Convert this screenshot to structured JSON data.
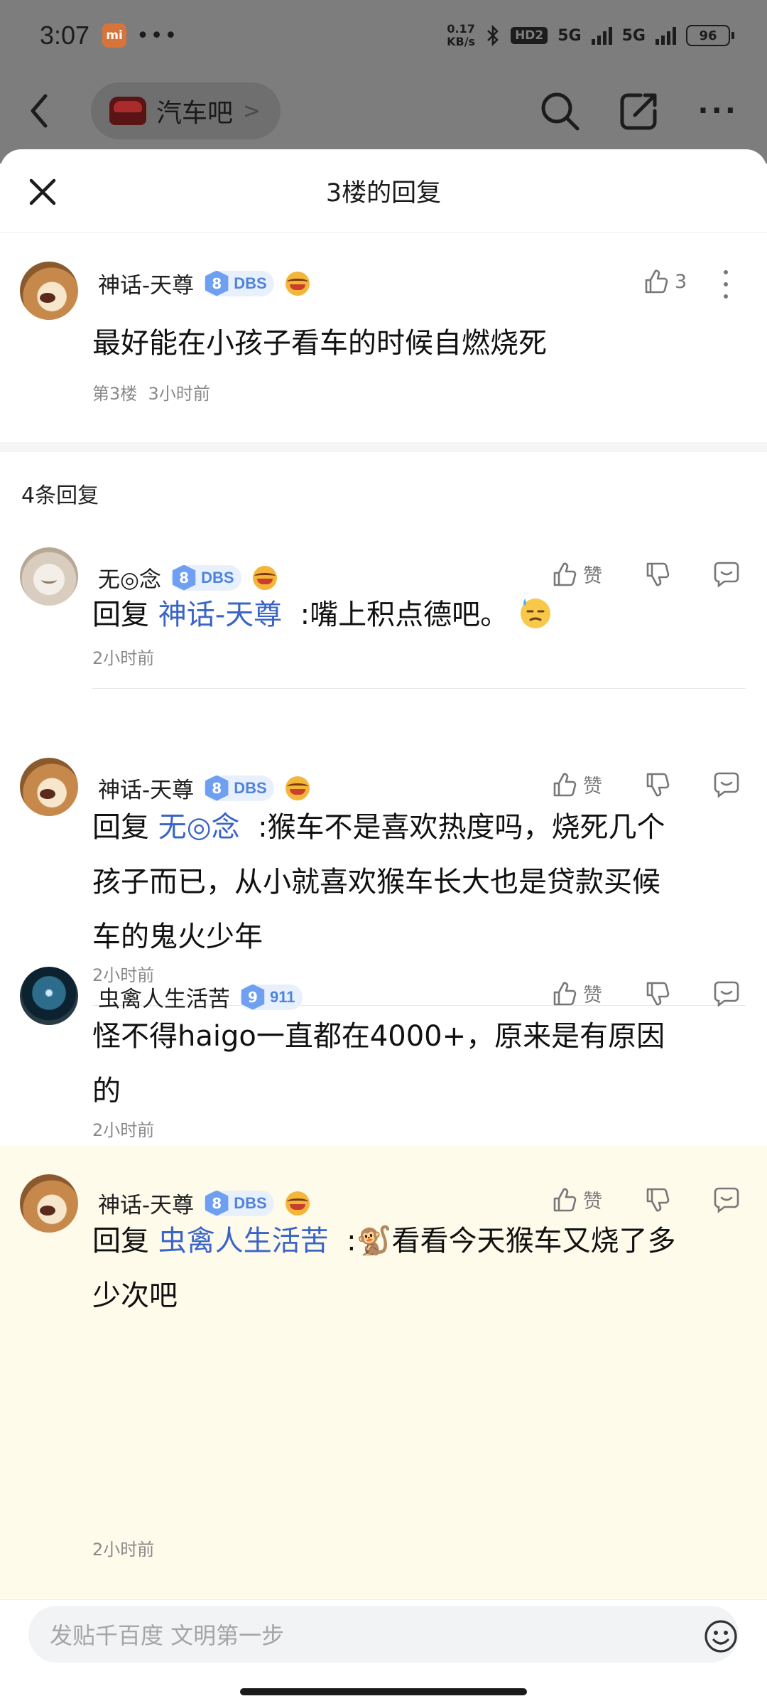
{
  "status_bar": {
    "time": "3:07",
    "net_speed_value": "0.17",
    "net_speed_unit": "KB/s",
    "network_1": "5G",
    "network_2": "5G",
    "hd_label": "HD2",
    "battery": "96"
  },
  "nav": {
    "forum_name": "汽车吧",
    "forum_arrow": ">",
    "more_icon": "more-dots"
  },
  "sheet": {
    "title": "3楼的回复"
  },
  "main_comment": {
    "username": "神话-天尊",
    "level": "8",
    "level_name": "DBS",
    "likes": "3",
    "text": "最好能在小孩子看车的时候自燃烧死",
    "floor": "第3楼",
    "time": "3小时前"
  },
  "reply_count": "4条回复",
  "reply_prefix": "回复",
  "like_label": "赞",
  "replies": [
    {
      "username": "无◎念",
      "level": "8",
      "level_name": "DBS",
      "target": "神话-天尊",
      "text": ":嘴上积点德吧。",
      "emoji": "sweat-face-emoji",
      "time": "2小时前"
    },
    {
      "username": "神话-天尊",
      "level": "8",
      "level_name": "DBS",
      "target": "无◎念",
      "text_line1": ":猴车不是喜欢热度吗，烧死几个",
      "text_line2": "孩子而已，从小就喜欢猴车长大也是贷款买候",
      "text_line3": "车的鬼火少年",
      "time": "2小时前"
    },
    {
      "username": "虫禽人生活苦",
      "level": "9",
      "level_name": "911",
      "text_line1": "怪不得haigo一直都在4000+，原来是有原因",
      "text_line2": "的",
      "time": "2小时前"
    },
    {
      "username": "神话-天尊",
      "level": "8",
      "level_name": "DBS",
      "target": "虫禽人生活苦",
      "text_colon": ":",
      "emoji": "🐒",
      "text_line1": "看看今天猴车又烧了多",
      "text_line2": "少次吧",
      "time": "2小时前"
    }
  ],
  "input": {
    "placeholder": "发贴千百度 文明第一步"
  },
  "colors": {
    "accent": "#3a64c8",
    "highlight_bg": "#fefbeb",
    "level_badge": "#6e9ff0"
  }
}
